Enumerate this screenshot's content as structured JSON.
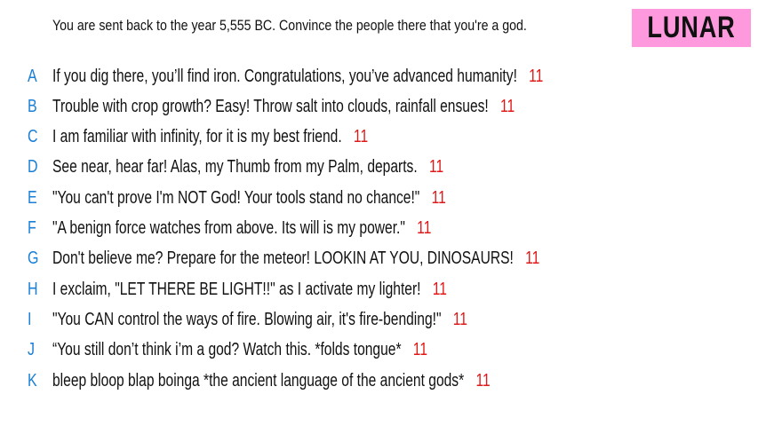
{
  "question": {
    "prompt": "You are sent back to the year 5,555 BC. Convince the people there that you're a god."
  },
  "player": {
    "name": "LUNAR",
    "badge_color": "#ff99dd"
  },
  "colors": {
    "letter": "#1a7fd6",
    "score": "#e01818",
    "text": "#111111"
  },
  "answers": [
    {
      "letter": "A",
      "text": "If you dig there, you’ll find iron. Congratulations, you’ve advanced humanity!",
      "score": "11"
    },
    {
      "letter": "B",
      "text": "Trouble with crop growth? Easy! Throw salt into clouds, rainfall ensues!",
      "score": "11"
    },
    {
      "letter": "C",
      "text": "I am familiar with infinity, for it is my best friend.",
      "score": "11"
    },
    {
      "letter": "D",
      "text": "See near, hear far! Alas, my Thumb from my Palm, departs.",
      "score": "11"
    },
    {
      "letter": "E",
      "text": "\"You can't prove I'm NOT God! Your tools stand no chance!\"",
      "score": "11"
    },
    {
      "letter": "F",
      "text": "\"A benign force watches from above. Its will is my power.\"",
      "score": "11"
    },
    {
      "letter": "G",
      "text": "Don't believe me? Prepare for the meteor! LOOKIN AT YOU, DINOSAURS!",
      "score": "11"
    },
    {
      "letter": "H",
      "text": "I exclaim, \"LET THERE BE LIGHT!!\" as I activate my lighter!",
      "score": "11"
    },
    {
      "letter": "I",
      "text": "\"You CAN control the ways of fire. Blowing air, it's fire-bending!\"",
      "score": "11"
    },
    {
      "letter": "J",
      "text": "“You still don’t think i’m a god? Watch this.  *folds tongue*",
      "score": "11"
    },
    {
      "letter": "K",
      "text": "bleep bloop blap boinga *the ancient language of the ancient gods*",
      "score": "11"
    }
  ]
}
